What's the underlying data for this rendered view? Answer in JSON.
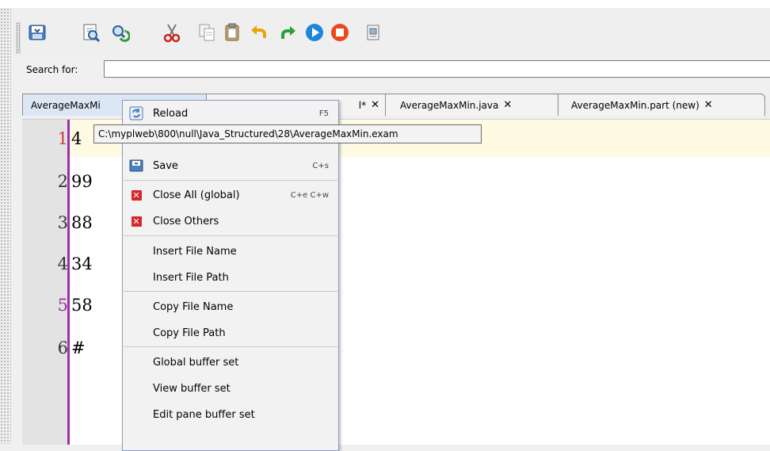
{
  "toolbar": {
    "buttons": [
      {
        "icon": "save-icon"
      },
      {
        "icon": "find-icon"
      },
      {
        "icon": "replace-icon"
      },
      {
        "icon": "cut-icon"
      },
      {
        "icon": "copy-icon"
      },
      {
        "icon": "paste-icon"
      },
      {
        "icon": "undo-icon"
      },
      {
        "icon": "redo-icon"
      },
      {
        "icon": "run-icon"
      },
      {
        "icon": "stop-icon"
      },
      {
        "icon": "document-icon"
      }
    ]
  },
  "search": {
    "label": "Search for:",
    "value": ""
  },
  "tabs": [
    {
      "label": "AverageMaxMi",
      "close": ""
    },
    {
      "label": "l*",
      "close": "✕"
    },
    {
      "label": "AverageMaxMin.java",
      "close": "✕"
    },
    {
      "label": "AverageMaxMin.part (new)",
      "close": "✕"
    }
  ],
  "editor": {
    "lines": [
      {
        "num": "1",
        "text": "4"
      },
      {
        "num": "2",
        "text": "99"
      },
      {
        "num": "3",
        "text": "88"
      },
      {
        "num": "4",
        "text": "34"
      },
      {
        "num": "5",
        "text": "58"
      },
      {
        "num": "6",
        "text": "#"
      }
    ]
  },
  "tooltip": {
    "text": "C:\\myplweb\\800\\null\\Java_Structured\\28\\AverageMaxMin.exam"
  },
  "context_menu": {
    "items": [
      {
        "label": "Reload",
        "shortcut": "F5",
        "icon": "reload-icon"
      },
      {
        "label": "Save",
        "shortcut": "C+s",
        "icon": "save-icon"
      },
      {
        "label": "Close All (global)",
        "shortcut": "C+e C+w",
        "icon": "close-icon"
      },
      {
        "label": "Close Others",
        "shortcut": "",
        "icon": "close-icon"
      },
      {
        "label": "Insert File Name",
        "shortcut": ""
      },
      {
        "label": "Insert File Path",
        "shortcut": ""
      },
      {
        "label": "Copy File Name",
        "shortcut": ""
      },
      {
        "label": "Copy File Path",
        "shortcut": ""
      },
      {
        "label": "Global buffer set",
        "shortcut": ""
      },
      {
        "label": "View buffer set",
        "shortcut": ""
      },
      {
        "label": "Edit pane buffer set",
        "shortcut": ""
      }
    ]
  },
  "colors": {
    "gutter_accent": "#9b2fa8",
    "current_line": "#fffbe3",
    "active_tab": "#dbe7f5"
  }
}
